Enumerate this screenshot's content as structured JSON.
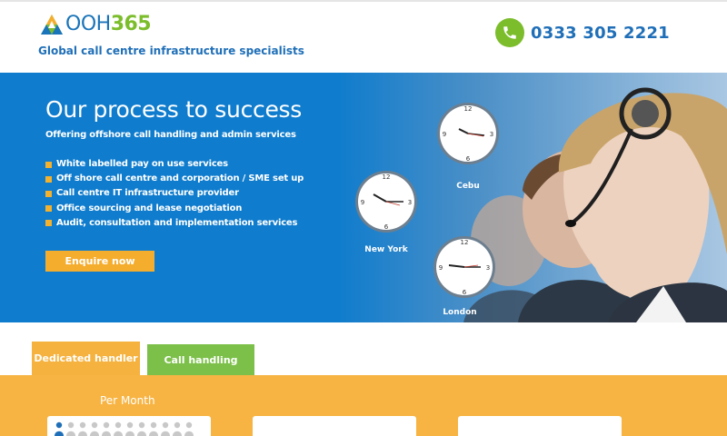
{
  "header": {
    "logo_text_a": "OOH",
    "logo_text_b": "365",
    "tagline": "Global call centre infrastructure specialists",
    "phone": "0333 305 2221",
    "phone_icon": "phone-icon",
    "brand_blue": "#1f6fb8",
    "brand_green": "#7cbd2c"
  },
  "hero": {
    "title": "Our process to success",
    "subtitle": "Offering offshore call handling and admin services",
    "bullets": [
      "White labelled pay on use services",
      "Off shore call centre and corporation / SME set up",
      "Call centre IT infrastructure provider",
      "Office sourcing and lease negotiation",
      "Audit, consultation and implementation services"
    ],
    "cta": "Enquire now",
    "clocks": [
      {
        "label": "Cebu"
      },
      {
        "label": "New York"
      },
      {
        "label": "London"
      }
    ]
  },
  "tabs": {
    "active": "Dedicated handler",
    "inactive": "Call handling"
  },
  "pricing": {
    "per_month": "Per Month"
  }
}
